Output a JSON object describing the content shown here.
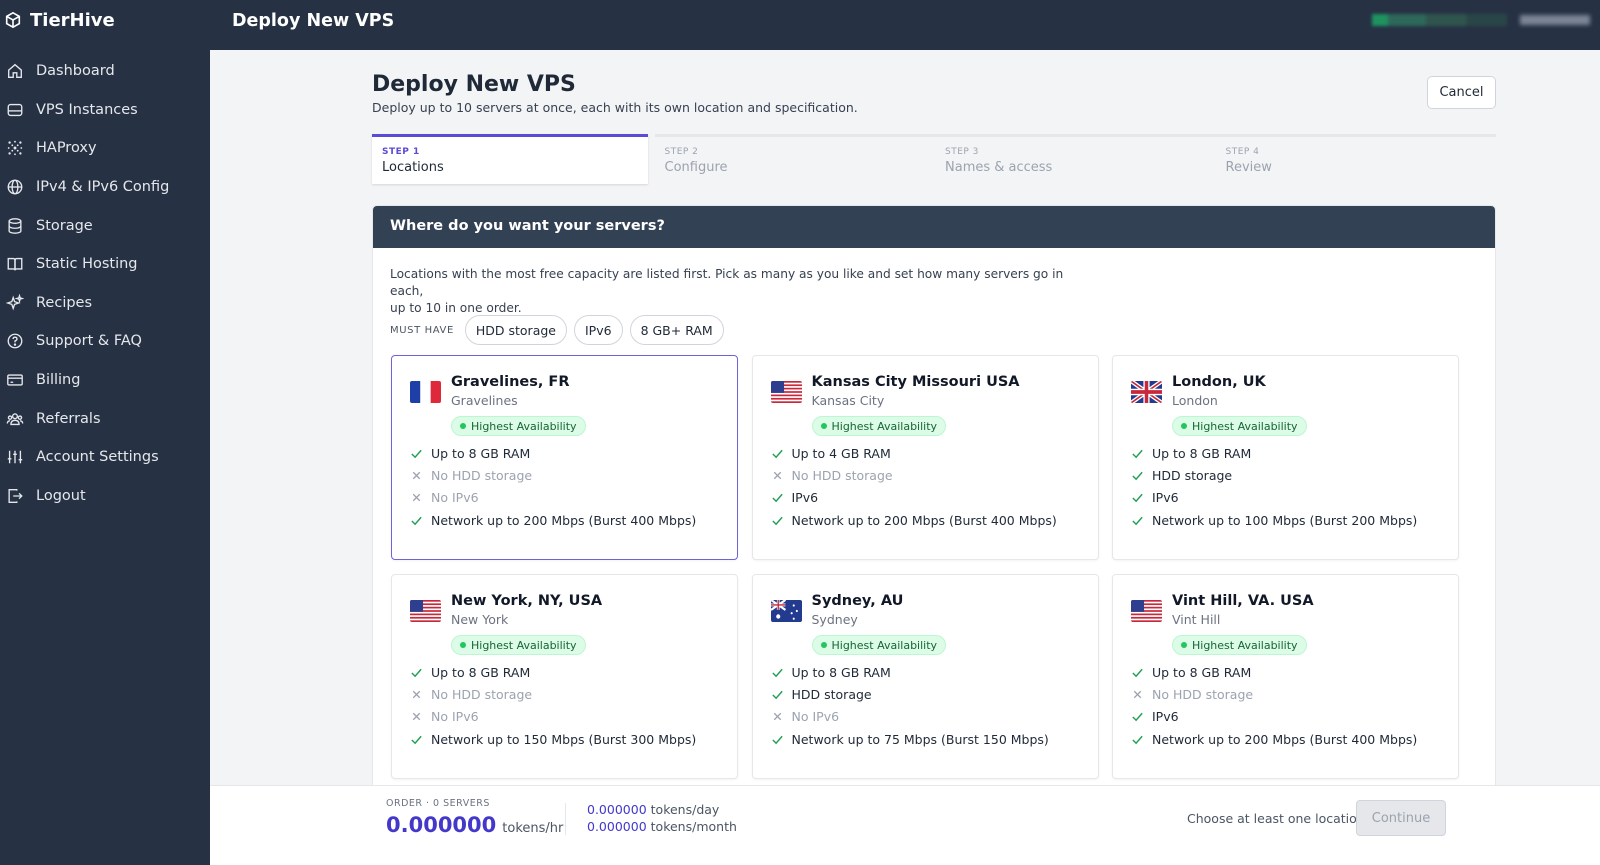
{
  "app": {
    "name": "TierHive"
  },
  "sidebar": {
    "items": [
      {
        "label": "Dashboard",
        "icon": "home-icon"
      },
      {
        "label": "VPS Instances",
        "icon": "server-icon"
      },
      {
        "label": "HAProxy",
        "icon": "network-icon"
      },
      {
        "label": "IPv4 & IPv6 Config",
        "icon": "globe-icon"
      },
      {
        "label": "Storage",
        "icon": "database-icon"
      },
      {
        "label": "Static Hosting",
        "icon": "book-icon"
      },
      {
        "label": "Recipes",
        "icon": "sparkles-icon"
      },
      {
        "label": "Support & FAQ",
        "icon": "help-icon"
      },
      {
        "label": "Billing",
        "icon": "credit-card-icon"
      },
      {
        "label": "Referrals",
        "icon": "users-icon"
      },
      {
        "label": "Account Settings",
        "icon": "sliders-icon"
      },
      {
        "label": "Logout",
        "icon": "logout-icon"
      }
    ]
  },
  "topbar": {
    "title": "Deploy New VPS"
  },
  "page": {
    "title": "Deploy New VPS",
    "subtitle": "Deploy up to 10 servers at once, each with its own location and specification.",
    "cancel_label": "Cancel"
  },
  "steps": [
    {
      "num": "STEP 1",
      "label": "Locations",
      "active": true
    },
    {
      "num": "STEP 2",
      "label": "Configure",
      "active": false
    },
    {
      "num": "STEP 3",
      "label": "Names & access",
      "active": false
    },
    {
      "num": "STEP 4",
      "label": "Review",
      "active": false
    }
  ],
  "panel": {
    "heading": "Where do you want your servers?",
    "intro_line1": "Locations with the most free capacity are listed first. Pick as many as you like and set how many servers go in each,",
    "intro_line2": "up to 10 in one order.",
    "must_have_label": "MUST HAVE",
    "filters": [
      "HDD storage",
      "IPv6",
      "8 GB+ RAM"
    ]
  },
  "locations": [
    {
      "title": "Gravelines, FR",
      "sub": "Gravelines",
      "flag": "fr",
      "badge": "Highest Availability",
      "selected": true,
      "features": [
        {
          "text": "Up to 8 GB RAM",
          "ok": true
        },
        {
          "text": "No HDD storage",
          "ok": false
        },
        {
          "text": "No IPv6",
          "ok": false
        },
        {
          "text": "Network up to 200 Mbps (Burst 400 Mbps)",
          "ok": true
        }
      ]
    },
    {
      "title": "Kansas City Missouri USA",
      "sub": "Kansas City",
      "flag": "us",
      "badge": "Highest Availability",
      "selected": false,
      "features": [
        {
          "text": "Up to 4 GB RAM",
          "ok": true
        },
        {
          "text": "No HDD storage",
          "ok": false
        },
        {
          "text": "IPv6",
          "ok": true
        },
        {
          "text": "Network up to 200 Mbps (Burst 400 Mbps)",
          "ok": true
        }
      ]
    },
    {
      "title": "London, UK",
      "sub": "London",
      "flag": "uk",
      "badge": "Highest Availability",
      "selected": false,
      "features": [
        {
          "text": "Up to 8 GB RAM",
          "ok": true
        },
        {
          "text": "HDD storage",
          "ok": true
        },
        {
          "text": "IPv6",
          "ok": true
        },
        {
          "text": "Network up to 100 Mbps (Burst 200 Mbps)",
          "ok": true
        }
      ]
    },
    {
      "title": "New York, NY, USA",
      "sub": "New York",
      "flag": "us",
      "badge": "Highest Availability",
      "selected": false,
      "features": [
        {
          "text": "Up to 8 GB RAM",
          "ok": true
        },
        {
          "text": "No HDD storage",
          "ok": false
        },
        {
          "text": "No IPv6",
          "ok": false
        },
        {
          "text": "Network up to 150 Mbps (Burst 300 Mbps)",
          "ok": true
        }
      ]
    },
    {
      "title": "Sydney, AU",
      "sub": "Sydney",
      "flag": "au",
      "badge": "Highest Availability",
      "selected": false,
      "features": [
        {
          "text": "Up to 8 GB RAM",
          "ok": true
        },
        {
          "text": "HDD storage",
          "ok": true
        },
        {
          "text": "No IPv6",
          "ok": false
        },
        {
          "text": "Network up to 75 Mbps (Burst 150 Mbps)",
          "ok": true
        }
      ]
    },
    {
      "title": "Vint Hill, VA. USA",
      "sub": "Vint Hill",
      "flag": "us",
      "badge": "Highest Availability",
      "selected": false,
      "features": [
        {
          "text": "Up to 8 GB RAM",
          "ok": true
        },
        {
          "text": "No HDD storage",
          "ok": false
        },
        {
          "text": "IPv6",
          "ok": true
        },
        {
          "text": "Network up to 200 Mbps (Burst 400 Mbps)",
          "ok": true
        }
      ]
    }
  ],
  "order": {
    "label": "ORDER · 0 SERVERS",
    "hourly": "0.000000",
    "hourly_unit": "tokens/hr",
    "daily": "0.000000",
    "daily_unit": "tokens/day",
    "monthly": "0.000000",
    "monthly_unit": "tokens/month",
    "hint": "Choose at least one location",
    "continue_label": "Continue"
  },
  "colors": {
    "sidebar": "#263244",
    "accent": "#5b4bd6",
    "price": "#4338ca",
    "success": "#22c55e"
  }
}
